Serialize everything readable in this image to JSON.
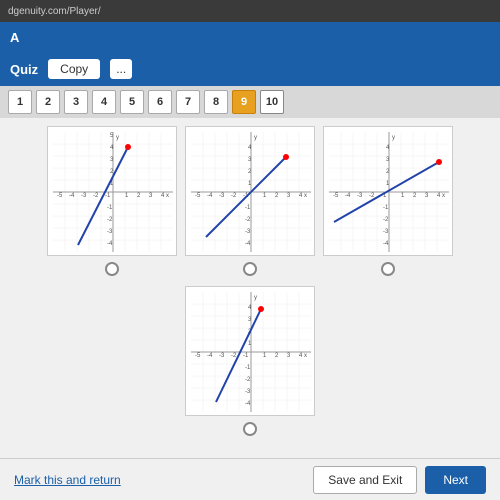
{
  "browser": {
    "url": "dgenuity.com/Player/"
  },
  "app": {
    "title": "A"
  },
  "quiz": {
    "label": "Quiz",
    "copy_btn": "Copy",
    "ellipsis": "..."
  },
  "question_numbers": {
    "items": [
      {
        "label": "1",
        "state": "default"
      },
      {
        "label": "2",
        "state": "default"
      },
      {
        "label": "3",
        "state": "default"
      },
      {
        "label": "4",
        "state": "default"
      },
      {
        "label": "5",
        "state": "default"
      },
      {
        "label": "6",
        "state": "default"
      },
      {
        "label": "7",
        "state": "default"
      },
      {
        "label": "8",
        "state": "default"
      },
      {
        "label": "9",
        "state": "active"
      },
      {
        "label": "10",
        "state": "outline"
      }
    ]
  },
  "footer": {
    "mark_return": "Mark this and return",
    "save_exit": "Save and Exit",
    "next": "Next"
  }
}
